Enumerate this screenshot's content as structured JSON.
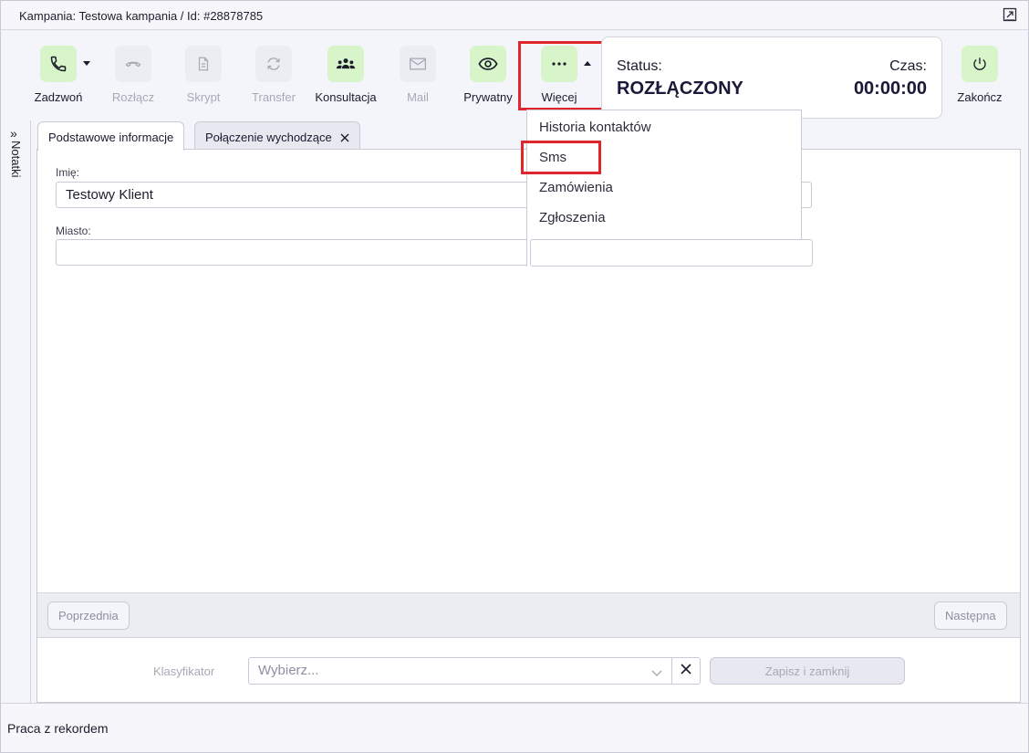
{
  "window": {
    "title": "Kampania: Testowa kampania / Id: #28878785"
  },
  "toolbar": {
    "buttons": [
      {
        "label": "Zadzwoń",
        "icon": "phone-icon",
        "enabled": true
      },
      {
        "label": "Rozłącz",
        "icon": "hangup-icon",
        "enabled": false
      },
      {
        "label": "Skrypt",
        "icon": "document-icon",
        "enabled": false
      },
      {
        "label": "Transfer",
        "icon": "transfer-icon",
        "enabled": false
      },
      {
        "label": "Konsultacja",
        "icon": "group-icon",
        "enabled": true
      },
      {
        "label": "Mail",
        "icon": "mail-icon",
        "enabled": false
      },
      {
        "label": "Prywatny",
        "icon": "eye-icon",
        "enabled": true
      },
      {
        "label": "Więcej",
        "icon": "more-dots-icon",
        "enabled": true
      },
      {
        "label": "Zakończ",
        "icon": "power-icon",
        "enabled": true
      }
    ]
  },
  "status": {
    "status_label": "Status:",
    "status_value": "ROZŁĄCZONY",
    "time_label": "Czas:",
    "time_value": "00:00:00"
  },
  "sidebar": {
    "notes_label": "Notatki"
  },
  "tabs": [
    {
      "label": "Podstawowe informacje",
      "active": true,
      "closable": false
    },
    {
      "label": "Połączenie wychodzące",
      "active": false,
      "closable": true
    }
  ],
  "form": {
    "fields": [
      {
        "label": "Imię:",
        "value": "Testowy Klient"
      },
      {
        "label": "Miasto:",
        "value": ""
      }
    ]
  },
  "navigation": {
    "prev_label": "Poprzednia",
    "next_label": "Następna"
  },
  "classifier": {
    "label": "Klasyfikator",
    "placeholder": "Wybierz...",
    "save_label": "Zapisz i zamknij"
  },
  "footer": {
    "text": "Praca z rekordem"
  },
  "more_menu": {
    "items": [
      "Historia kontaktów",
      "Sms",
      "Zamówienia",
      "Zgłoszenia"
    ]
  },
  "colors": {
    "accent_green": "#d7f5c8",
    "highlight_red": "#e0262d",
    "dark_text": "#1a1a38"
  }
}
